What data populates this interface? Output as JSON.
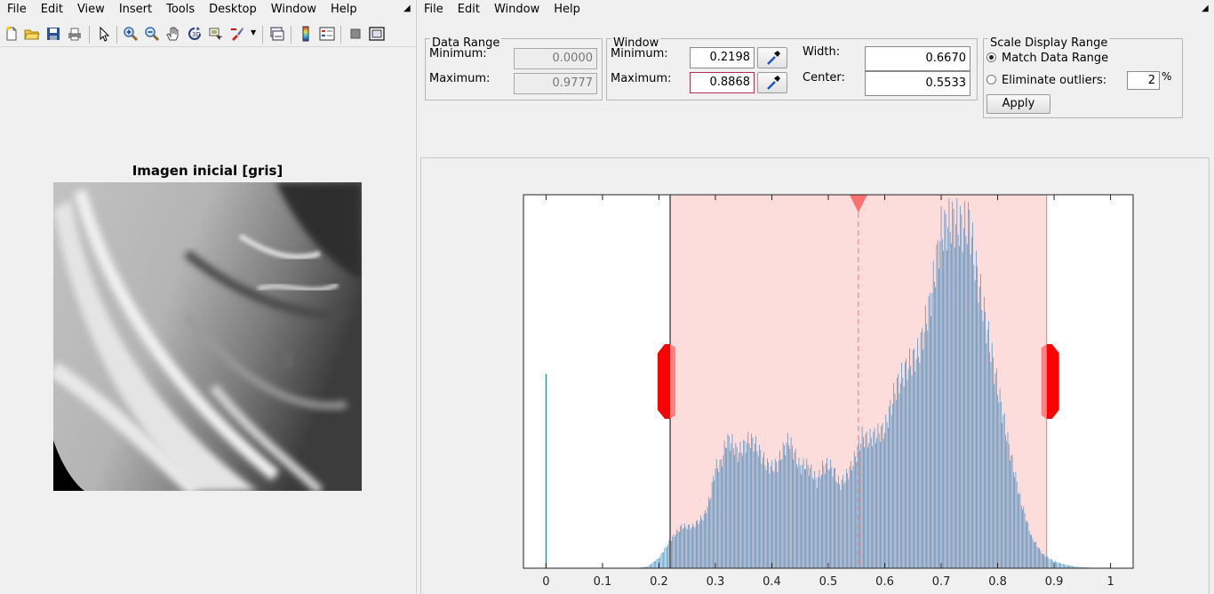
{
  "left_window": {
    "menu": [
      "File",
      "Edit",
      "View",
      "Insert",
      "Tools",
      "Desktop",
      "Window",
      "Help"
    ],
    "toolbar_icons": [
      "new-file-icon",
      "open-folder-icon",
      "save-icon",
      "print-icon",
      "pointer-icon",
      "zoom-in-icon",
      "zoom-out-icon",
      "pan-icon",
      "rotate-3d-icon",
      "data-cursor-icon",
      "brush-icon",
      "brush-dropdown-icon",
      "link-plot-icon",
      "colorbar-icon",
      "legend-icon",
      "hide-plot-tools-icon",
      "show-plot-tools-icon"
    ],
    "figure_title": "Imagen inicial [gris]"
  },
  "right_window": {
    "menu": [
      "File",
      "Edit",
      "Window",
      "Help"
    ]
  },
  "data_range": {
    "title": "Data Range",
    "min_label": "Minimum:",
    "min_value": "0.0000",
    "max_label": "Maximum:",
    "max_value": "0.9777"
  },
  "window": {
    "title": "Window",
    "min_label": "Minimum:",
    "min_value": "0.2198",
    "max_label": "Maximum:",
    "max_value": "0.8868",
    "width_label": "Width:",
    "width_value": "0.6670",
    "center_label": "Center:",
    "center_value": "0.5533"
  },
  "scale_display": {
    "title": "Scale Display Range",
    "option_match": "Match Data Range",
    "option_eliminate": "Eliminate outliers:",
    "outlier_value": "2",
    "percent": "%",
    "apply_label": "Apply",
    "selected": "match"
  },
  "colors": {
    "window_fill": "#fddcdc",
    "handle_red": "#ff0000",
    "histogram": "#1f77b4",
    "marker": "#ff7070"
  },
  "chart_data": {
    "type": "bar",
    "xlim": [
      -0.04,
      1.04
    ],
    "ylim": [
      0,
      1
    ],
    "xticks": [
      0,
      0.1,
      0.2,
      0.3,
      0.4,
      0.5,
      0.6,
      0.7,
      0.8,
      0.9,
      1
    ],
    "window_range": [
      0.2198,
      0.8868
    ],
    "window_center": 0.5533,
    "spike": {
      "x": 0,
      "y": 0.52
    },
    "profile_x": [
      0.0,
      0.16,
      0.18,
      0.2,
      0.22,
      0.24,
      0.26,
      0.28,
      0.29,
      0.3,
      0.31,
      0.32,
      0.33,
      0.34,
      0.35,
      0.36,
      0.37,
      0.38,
      0.39,
      0.4,
      0.41,
      0.42,
      0.43,
      0.44,
      0.45,
      0.46,
      0.47,
      0.48,
      0.49,
      0.5,
      0.51,
      0.52,
      0.53,
      0.54,
      0.55,
      0.56,
      0.57,
      0.58,
      0.6,
      0.62,
      0.64,
      0.66,
      0.68,
      0.7,
      0.72,
      0.74,
      0.75,
      0.76,
      0.78,
      0.8,
      0.82,
      0.84,
      0.86,
      0.88,
      0.9,
      0.92,
      0.94,
      0.97,
      1.0
    ],
    "profile_y": [
      0.0,
      0.0,
      0.005,
      0.03,
      0.08,
      0.12,
      0.12,
      0.15,
      0.2,
      0.29,
      0.3,
      0.37,
      0.36,
      0.33,
      0.35,
      0.37,
      0.36,
      0.33,
      0.3,
      0.29,
      0.3,
      0.34,
      0.37,
      0.33,
      0.29,
      0.3,
      0.28,
      0.25,
      0.29,
      0.3,
      0.28,
      0.24,
      0.26,
      0.29,
      0.33,
      0.38,
      0.37,
      0.38,
      0.4,
      0.52,
      0.58,
      0.62,
      0.76,
      0.97,
      1.0,
      0.98,
      1.0,
      0.88,
      0.7,
      0.52,
      0.35,
      0.2,
      0.09,
      0.04,
      0.02,
      0.01,
      0.004,
      0.001,
      0.0
    ]
  }
}
